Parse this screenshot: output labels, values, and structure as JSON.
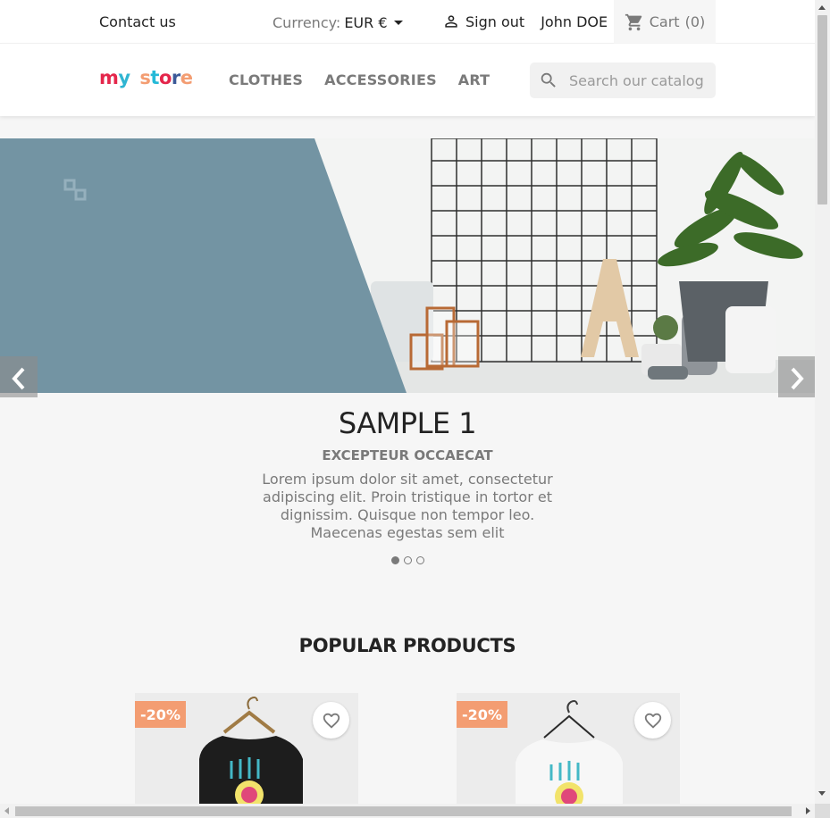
{
  "topbar": {
    "contact": "Contact us",
    "currency_label": "Currency:",
    "currency_value": "EUR €",
    "sign_out": "Sign out",
    "user_name": "John DOE",
    "cart_label": "Cart",
    "cart_count": "(0)"
  },
  "header": {
    "logo_word1": "my",
    "logo_word2": "store",
    "nav": [
      "CLOTHES",
      "ACCESSORIES",
      "ART"
    ],
    "search_placeholder": "Search our catalog"
  },
  "carousel": {
    "title": "SAMPLE 1",
    "subtitle": "EXCEPTEUR OCCAECAT",
    "description": "Lorem ipsum dolor sit amet, consectetur adipiscing elit. Proin tristique in tortor et dignissim. Quisque non tempor leo. Maecenas egestas sem elit",
    "slide_count": 3,
    "active_slide": 1
  },
  "popular": {
    "title": "POPULAR PRODUCTS",
    "products": [
      {
        "badge": "-20%",
        "shirt_color": "#1d1d1d"
      },
      {
        "badge": "-20%",
        "shirt_color": "#f7f7f7"
      }
    ]
  },
  "colors": {
    "banner_blue": "#7394a3",
    "badge": "#f39d72",
    "logo_m": "#e4264b",
    "logo_y": "#2fb5d2",
    "logo_s": "#f39d72",
    "logo_t": "#24b9d7",
    "logo_o": "#e4264b",
    "logo_r": "#3b5998",
    "logo_e": "#f39d72"
  }
}
